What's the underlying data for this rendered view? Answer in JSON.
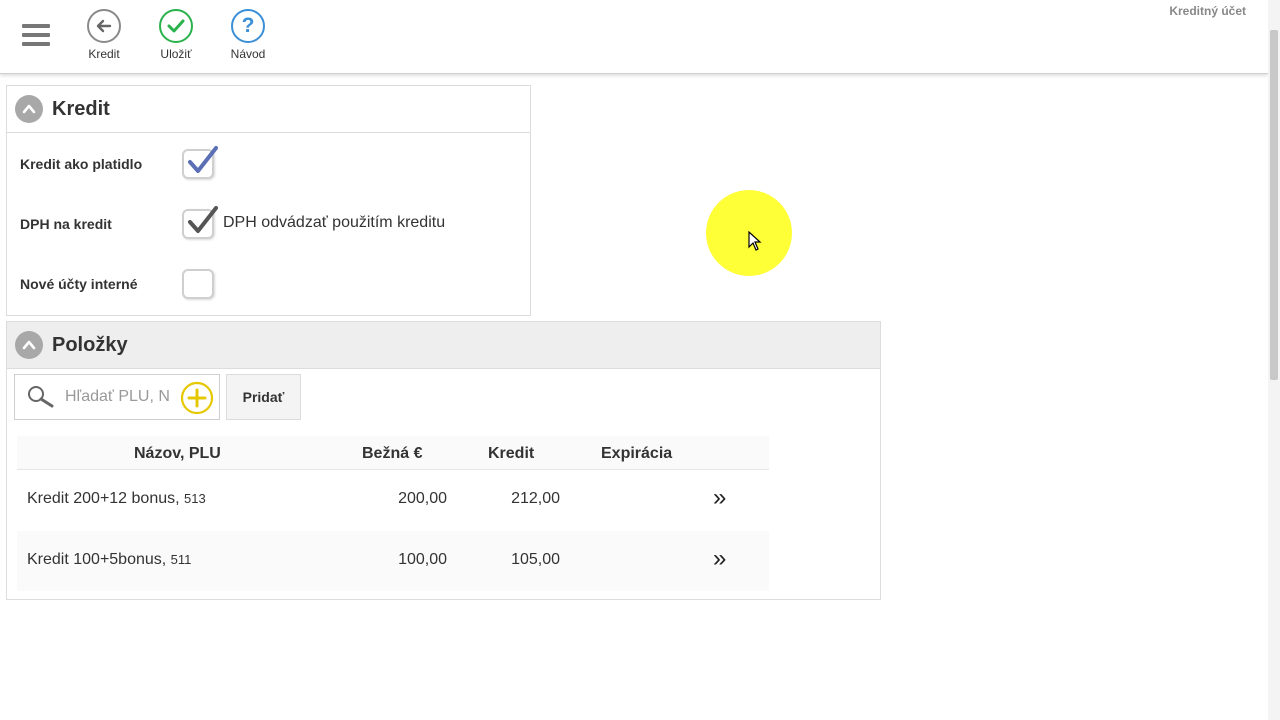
{
  "app_title": "Kreditný účet",
  "toolbar": {
    "back_label": "Kredit",
    "save_label": "Uložiť",
    "help_label": "Návod",
    "help_glyph": "?"
  },
  "credit_panel": {
    "title": "Kredit",
    "rows": [
      {
        "label": "Kredit ako platidlo",
        "checked": true,
        "text": ""
      },
      {
        "label": "DPH na kredit",
        "checked": true,
        "text": "DPH odvádzať použitím kreditu"
      },
      {
        "label": "Nové účty interné",
        "checked": false,
        "text": ""
      }
    ]
  },
  "items_panel": {
    "title": "Položky",
    "search_placeholder": "Hľadať PLU, N",
    "add_label": "Pridať",
    "columns": [
      "Názov, PLU",
      "Bežná €",
      "Kredit",
      "Expirácia"
    ],
    "rows": [
      {
        "name": "Kredit 200+12 bonus,",
        "plu": "513",
        "price": "200,00",
        "credit": "212,00",
        "expiry": "",
        "chevron": "»"
      },
      {
        "name": "Kredit 100+5bonus,",
        "plu": "511",
        "price": "100,00",
        "credit": "105,00",
        "expiry": "",
        "chevron": "»"
      }
    ]
  },
  "colors": {
    "check_blue": "#5b6fb5",
    "check_gray": "#555555",
    "add_plus_yellow": "#e6c800",
    "save_green": "#2bb24c",
    "help_blue": "#3a8fd6"
  }
}
